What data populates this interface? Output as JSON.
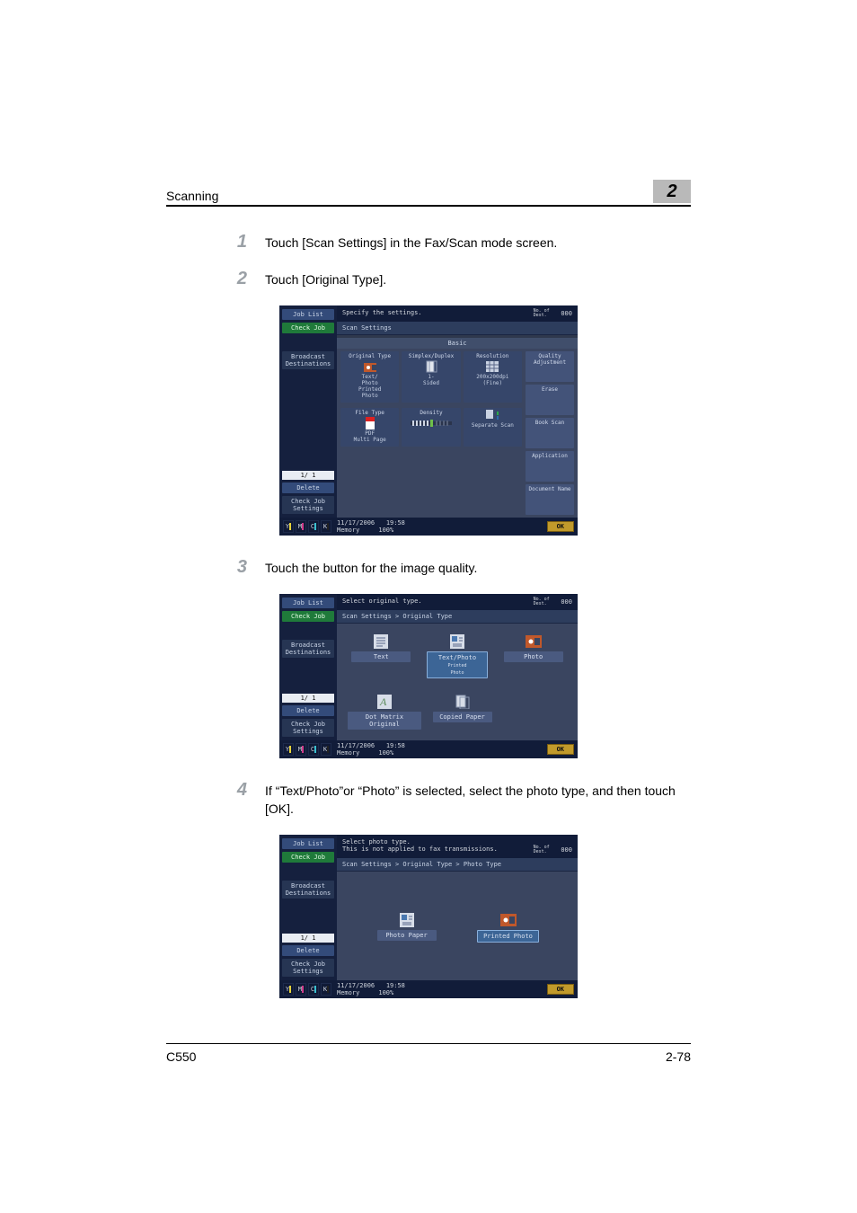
{
  "header": {
    "title": "Scanning",
    "chapter": "2"
  },
  "steps": [
    {
      "num": "1",
      "text": "Touch [Scan Settings] in the Fax/Scan mode screen."
    },
    {
      "num": "2",
      "text": "Touch [Original Type]."
    },
    {
      "num": "3",
      "text": "Touch the button for the image quality."
    },
    {
      "num": "4",
      "text": "If “Text/Photo”or “Photo” is selected, select the photo type, and then touch [OK]."
    }
  ],
  "panel_common": {
    "job_list": "Job List",
    "check_job": "Check Job",
    "broadcast": "Broadcast\nDestinations",
    "page_indicator": "1/ 1",
    "delete": "Delete",
    "check_job_settings": "Check Job\nSettings",
    "dest_label": "No. of\nDest.",
    "dest_count": "000",
    "date": "11/17/2006",
    "time": "19:58",
    "memory_label": "Memory",
    "memory_value": "100%",
    "ok": "OK",
    "ind_letters": [
      "Y",
      "M",
      "C",
      "K"
    ]
  },
  "panel1": {
    "instruction": "Specify the settings.",
    "crumb": "Scan Settings",
    "section": "Basic",
    "row1": [
      {
        "title": "Original Type",
        "sub": "Text/\nPhoto\nPrinted\nPhoto",
        "icon": "photo"
      },
      {
        "title": "Simplex/Duplex",
        "sub": "1-\nSided",
        "icon": "page"
      },
      {
        "title": "Resolution",
        "sub": "200x200dpi\n(Fine)",
        "icon": "grid"
      }
    ],
    "side_top": [
      "Quality\nAdjustment",
      "Erase",
      "Book Scan"
    ],
    "row2": [
      {
        "title": "File Type",
        "sub": "PDF\nMulti Page",
        "icon": "pdf"
      },
      {
        "title": "Density",
        "sub": "",
        "icon": "density"
      },
      {
        "title": "",
        "sub": "Separate Scan",
        "icon": "sepscan"
      }
    ],
    "side_bottom": [
      "Application",
      "Document Name"
    ]
  },
  "panel2": {
    "instruction": "Select original type.",
    "crumb": "Scan Settings > Original Type",
    "opts_row1": [
      {
        "label": "Text",
        "icon": "text"
      },
      {
        "label": "Text/Photo",
        "sub": "Printed\nPhoto",
        "icon": "textphoto",
        "selected": true
      },
      {
        "label": "Photo",
        "icon": "photo2"
      }
    ],
    "opts_row2": [
      {
        "label": "Dot Matrix Original",
        "icon": "dotmatrix"
      },
      {
        "label": "Copied Paper",
        "icon": "copied"
      }
    ]
  },
  "panel3": {
    "instruction": "Select photo type.\nThis is not applied to fax transmissions.",
    "crumb": "Scan Settings > Original Type > Photo Type",
    "opts": [
      {
        "label": "Photo Paper",
        "icon": "photopaper"
      },
      {
        "label": "Printed Photo",
        "icon": "printedphoto",
        "selected": true
      }
    ]
  },
  "footer": {
    "left": "C550",
    "right": "2-78"
  }
}
